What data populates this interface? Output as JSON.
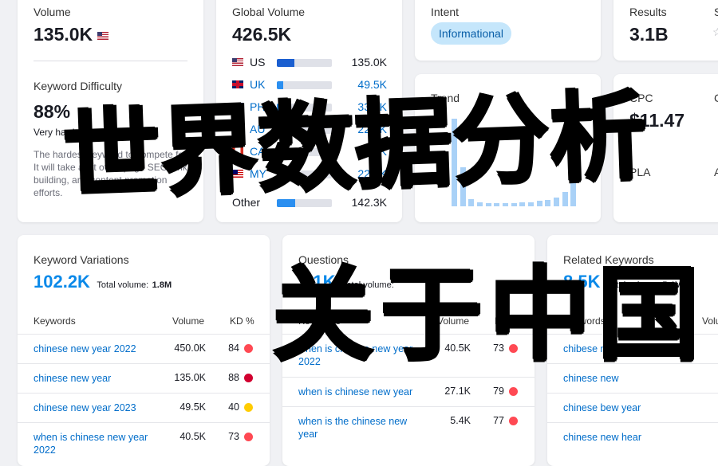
{
  "volume": {
    "label": "Volume",
    "value": "135.0K"
  },
  "difficulty": {
    "label": "Keyword Difficulty",
    "value": "88%",
    "level": "Very hard",
    "description": "The hardest keyword to compete for. It will take a lot of on-page SEO, link building, and content promotion efforts."
  },
  "global_volume": {
    "label": "Global Volume",
    "value": "426.5K",
    "rows": [
      {
        "code": "US",
        "value": "135.0K",
        "share": 0.32,
        "flag": "us"
      },
      {
        "code": "UK",
        "value": "49.5K",
        "share": 0.12,
        "flag": "uk"
      },
      {
        "code": "PH",
        "value": "33.1K",
        "share": 0.08,
        "flag": "ph"
      },
      {
        "code": "AU",
        "value": "22.2K",
        "share": 0.05,
        "flag": "au"
      },
      {
        "code": "CA",
        "value": "22.2K",
        "share": 0.05,
        "flag": "ca"
      },
      {
        "code": "MY",
        "value": "22.2K",
        "share": 0.05,
        "flag": "my"
      }
    ],
    "other": {
      "label": "Other",
      "value": "142.3K",
      "share": 0.33
    }
  },
  "intent": {
    "label": "Intent",
    "badge": "Informational"
  },
  "trend": {
    "label": "Trend",
    "levels": [
      1.0,
      0.45,
      0.08,
      0.05,
      0.04,
      0.04,
      0.04,
      0.04,
      0.05,
      0.05,
      0.06,
      0.07,
      0.1,
      0.16,
      0.3
    ]
  },
  "results": {
    "label": "Results",
    "value": "3.1B",
    "cut_label": "S"
  },
  "cpc": {
    "label": "CPC",
    "value": "$11.47",
    "cut_label": "C"
  },
  "pla": {
    "label": "PLA",
    "cut_label": "A"
  },
  "variations": {
    "title": "Keyword Variations",
    "count": "102.2K",
    "total_label": "Total volume:",
    "total": "1.8M",
    "headers": {
      "kw": "Keywords",
      "vol": "Volume",
      "kd": "KD %"
    },
    "rows": [
      {
        "kw": "chinese new year 2022",
        "vol": "450.0K",
        "kd": "84",
        "color": "#ff4953"
      },
      {
        "kw": "chinese new year",
        "vol": "135.0K",
        "kd": "88",
        "color": "#d1002f"
      },
      {
        "kw": "chinese new year 2023",
        "vol": "49.5K",
        "kd": "40",
        "color": "#ffcc00"
      },
      {
        "kw": "when is chinese new year 2022",
        "vol": "40.5K",
        "kd": "73",
        "color": "#ff4953"
      }
    ]
  },
  "questions": {
    "title": "Questions",
    "count": "7.1K",
    "total_label": "Total volume:",
    "total": "",
    "headers": {
      "kw": "Keywords",
      "vol": "Volume",
      "kd": "KD %"
    },
    "rows": [
      {
        "kw": "when is chinese new year 2022",
        "vol": "40.5K",
        "kd": "73",
        "color": "#ff4953"
      },
      {
        "kw": "when is chinese new year",
        "vol": "27.1K",
        "kd": "79",
        "color": "#ff4953"
      },
      {
        "kw": "when is the chinese new year",
        "vol": "5.4K",
        "kd": "77",
        "color": "#ff4953"
      }
    ]
  },
  "related": {
    "title": "Related Keywords",
    "count": "8.5K",
    "total_label": "Total volume:",
    "total": "5.4M",
    "headers": {
      "kw": "Keywords",
      "vol": "Volu"
    },
    "rows": [
      {
        "kw": "chibese new year"
      },
      {
        "kw": "chinese new"
      },
      {
        "kw": "chinese bew year"
      },
      {
        "kw": "chinese new hear"
      }
    ]
  },
  "overlay": {
    "line1": "世界数据分析",
    "line2": "关于中国"
  }
}
